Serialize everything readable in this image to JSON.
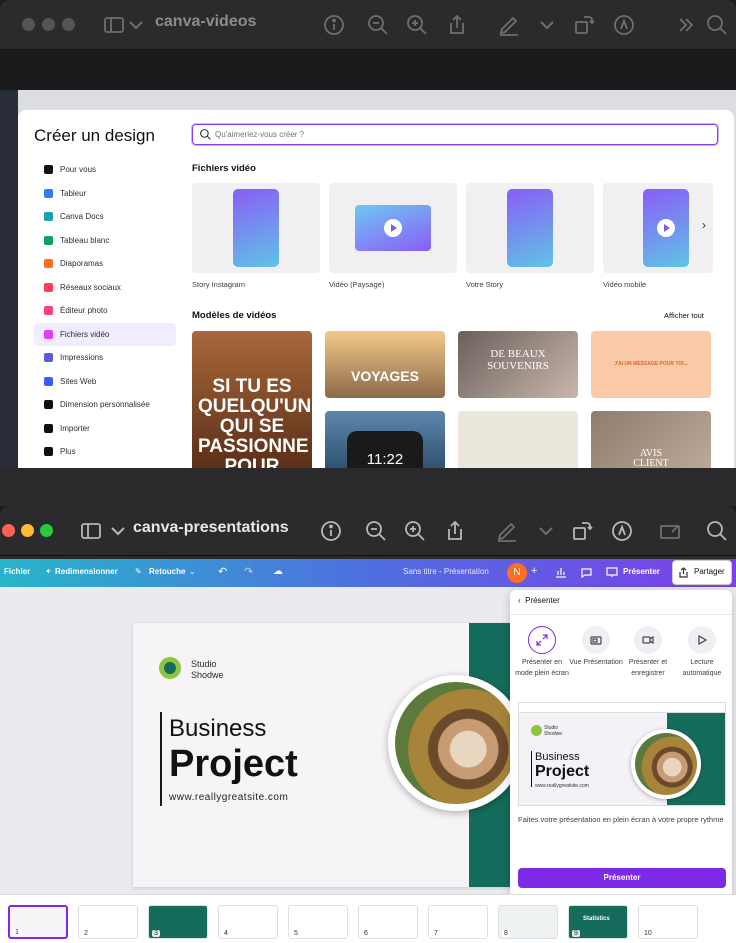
{
  "window1": {
    "title": "canva-videos",
    "modal": {
      "title": "Créer un design",
      "search_placeholder": "Qu'aimeriez-vous créer ?",
      "menu": [
        {
          "label": "Pour vous",
          "icon": "sparkle-icon",
          "color": "#0e1318"
        },
        {
          "label": "Tableur",
          "icon": "spreadsheet-icon",
          "color": "#2d7ff9"
        },
        {
          "label": "Canva Docs",
          "icon": "docs-icon",
          "color": "#13a3b5"
        },
        {
          "label": "Tableau blanc",
          "icon": "whiteboard-icon",
          "color": "#0ba360"
        },
        {
          "label": "Diaporamas",
          "icon": "presentation-icon",
          "color": "#ff6d1f"
        },
        {
          "label": "Réseaux sociaux",
          "icon": "heart-icon",
          "color": "#ff3b5c"
        },
        {
          "label": "Éditeur photo",
          "icon": "photo-icon",
          "color": "#ff4081"
        },
        {
          "label": "Fichiers vidéo",
          "icon": "video-icon",
          "color": "#e040fb"
        },
        {
          "label": "Impressions",
          "icon": "printer-icon",
          "color": "#5b5bd6"
        },
        {
          "label": "Sites Web",
          "icon": "website-icon",
          "color": "#3d5afe"
        },
        {
          "label": "Dimension personnalisée",
          "icon": "resize-icon",
          "color": "#0e1318"
        },
        {
          "label": "Importer",
          "icon": "cloud-upload-icon",
          "color": "#0e1318"
        },
        {
          "label": "Plus",
          "icon": "more-icon",
          "color": "#0e1318"
        }
      ],
      "active_index": 7,
      "section_video_files": "Fichiers vidéo",
      "video_types": [
        "Story Instagram",
        "Vidéo (Paysage)",
        "Votre Story",
        "Vidéo mobile"
      ],
      "section_templates": "Modèles de vidéos",
      "see_all": "Afficher tout",
      "templates": [
        {
          "text": "SI TU ES QUELQU'UN QUI SE PASSIONNE POUR"
        },
        {
          "text": "VOYAGES"
        },
        {
          "text": "DE BEAUX SOUVENIRS"
        },
        {
          "text": "J'AI UN MESSAGE POUR TOI..."
        },
        {
          "text": "11:22"
        },
        {
          "text": ""
        },
        {
          "text": "AVIS CLIENT"
        }
      ]
    }
  },
  "window2": {
    "title": "canva-presentations",
    "appbar": {
      "file": "Fichier",
      "resize": "Redimensionner",
      "retouch": "Retouche",
      "doc_title": "Sans titre - Présentation",
      "avatar": "N",
      "present": "Présenter",
      "share": "Partager"
    },
    "slide": {
      "brand_line1": "Studio",
      "brand_line2": "Shodwe",
      "heading1": "Business",
      "heading2": "Project",
      "url": "www.reallygreatsite.com"
    },
    "present_panel": {
      "back_label": "Présenter",
      "options": [
        {
          "label": "Présenter en mode plein écran",
          "icon": "fullscreen-icon"
        },
        {
          "label": "Vue Présentation",
          "icon": "presenter-view-icon"
        },
        {
          "label": "Présenter et enregistrer",
          "icon": "camera-icon"
        },
        {
          "label": "Lecture automatique",
          "icon": "play-icon"
        }
      ],
      "description": "Faites votre présentation en plein écran à votre propre rythme",
      "button": "Présenter"
    },
    "thumbnails": [
      "1",
      "2",
      "3",
      "4",
      "5",
      "6",
      "7",
      "8",
      "9",
      "10"
    ],
    "thumb_texts": {
      "t9": "Statistics"
    }
  }
}
